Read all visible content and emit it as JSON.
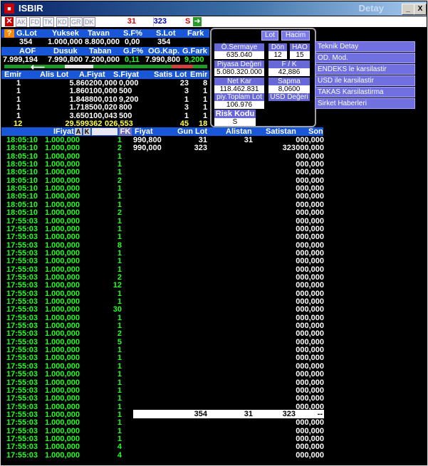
{
  "title": "ISBIR",
  "title_right": "Detay",
  "window_buttons": [
    "_",
    "□",
    "X"
  ],
  "toolbar": {
    "tabs": [
      "AK",
      "FD",
      "TK",
      "KD",
      "GR",
      "DK"
    ],
    "left_value": "31",
    "right_value": "323",
    "s_label": "S"
  },
  "summary": {
    "headers1": [
      "G.Lot",
      "Yuksek",
      "Tavan",
      "S.F%",
      "S.Lot",
      "Fark"
    ],
    "values1": [
      "354",
      "1.000,000",
      "8.800,000",
      "0,00",
      "354",
      ""
    ],
    "headers2": [
      "AOF",
      "Dusuk",
      "Taban",
      "G.F%",
      "OG.Kap.",
      "G.Fark"
    ],
    "values2": [
      "7.999,194",
      "7.990,800",
      "7.200,000",
      "0,11",
      "7.990,800",
      "9,200"
    ]
  },
  "depth": {
    "headers": [
      "Emir",
      "Alis Lot",
      "A.Fiyat",
      "S.Fiyat",
      "Satis Lot",
      "Emir"
    ],
    "rows": [
      [
        "1",
        "5.860",
        "200,000",
        "0,000",
        "23",
        "8"
      ],
      [
        "1",
        "1.860",
        "100,000",
        "500",
        "3",
        "1"
      ],
      [
        "1",
        "1.848",
        "800,010",
        "9,200",
        "1",
        "1"
      ],
      [
        "1",
        "1.718",
        "500,020",
        "800",
        "3",
        "1"
      ],
      [
        "1",
        "3.650",
        "100,043",
        "500",
        "1",
        "1"
      ]
    ],
    "total": [
      "12",
      "29.599",
      "362",
      "026,553",
      "45",
      "18"
    ]
  },
  "panel": {
    "top_buttons": [
      "Lot",
      "Hacim"
    ],
    "osermaye_label": "Ö.Sermaye",
    "osermaye_value": "635.040",
    "don_label": "Dön",
    "don_value": "12",
    "hao_label": "HAO",
    "hao_value": "15",
    "piyasa_label": "Piyasa Değeri",
    "piyasa_value": "5.080.320.000",
    "fk_label": "F / K",
    "fk_value": "42,886",
    "netkar_label": "Net Kar",
    "netkar_value": "118.462.831",
    "sapma_label": "Sapma",
    "sapma_value": "8,0600",
    "piy_label": "piy.Toplam Lot",
    "piy_value": "106.976",
    "usd_label": "USD Değeri",
    "usd_value": "",
    "risk_label": "Risk Kodu",
    "risk_value": "S"
  },
  "right_buttons": [
    "Teknik Detay",
    "OD. Mod.",
    "ENDEKS le karsilastir",
    "USD ile karsilastir",
    "TAKAS Karsilastirma",
    "Sirket Haberleri"
  ],
  "trades": {
    "headers": {
      "fiyat": "IFiyat",
      "a": "A",
      "k": "K",
      "fk": "FK",
      "fiyat2": "Fiyat",
      "gunlot": "Gun Lot",
      "alistan": "Alistan",
      "satistan": "Satistan",
      "son": "Son"
    },
    "times": [
      "18:05:10",
      "18:05:10",
      "18:05:10",
      "18:05:10",
      "18:05:10",
      "18:05:10",
      "18:05:10",
      "18:05:10",
      "18:05:10",
      "18:05:10",
      "17:55:03",
      "17:55:03",
      "17:55:03",
      "17:55:03",
      "17:55:03",
      "17:55:03",
      "17:55:03",
      "17:55:03",
      "17:55:03",
      "17:55:03",
      "17:55:03",
      "17:55:03",
      "17:55:03",
      "17:55:03",
      "17:55:03",
      "17:55:03",
      "17:55:03",
      "17:55:03",
      "17:55:03",
      "17:55:03",
      "17:55:03",
      "17:55:03",
      "17:55:03",
      "17:55:03",
      "17:55:03",
      "17:55:03",
      "17:55:03",
      "17:55:03",
      "17:55:03",
      "17:55:03"
    ],
    "lots": [
      "1",
      "2",
      "1",
      "1",
      "1",
      "2",
      "1",
      "1",
      "1",
      "2",
      "1",
      "1",
      "1",
      "8",
      "1",
      "1",
      "1",
      "2",
      "12",
      "1",
      "1",
      "30",
      "1",
      "1",
      "2",
      "5",
      "1",
      "1",
      "1",
      "1",
      "1",
      "1",
      "1",
      "1",
      "1",
      "1",
      "1",
      "1",
      "4",
      "4"
    ],
    "price": "1.000,000",
    "detail_rows": [
      [
        "990,800",
        "31",
        "31",
        ""
      ],
      [
        "990,000",
        "323",
        "",
        "323"
      ]
    ],
    "son_value": "000,000",
    "footer": {
      "gunlot": "354",
      "alistan": "31",
      "satistan": "323",
      "son": "--"
    }
  }
}
